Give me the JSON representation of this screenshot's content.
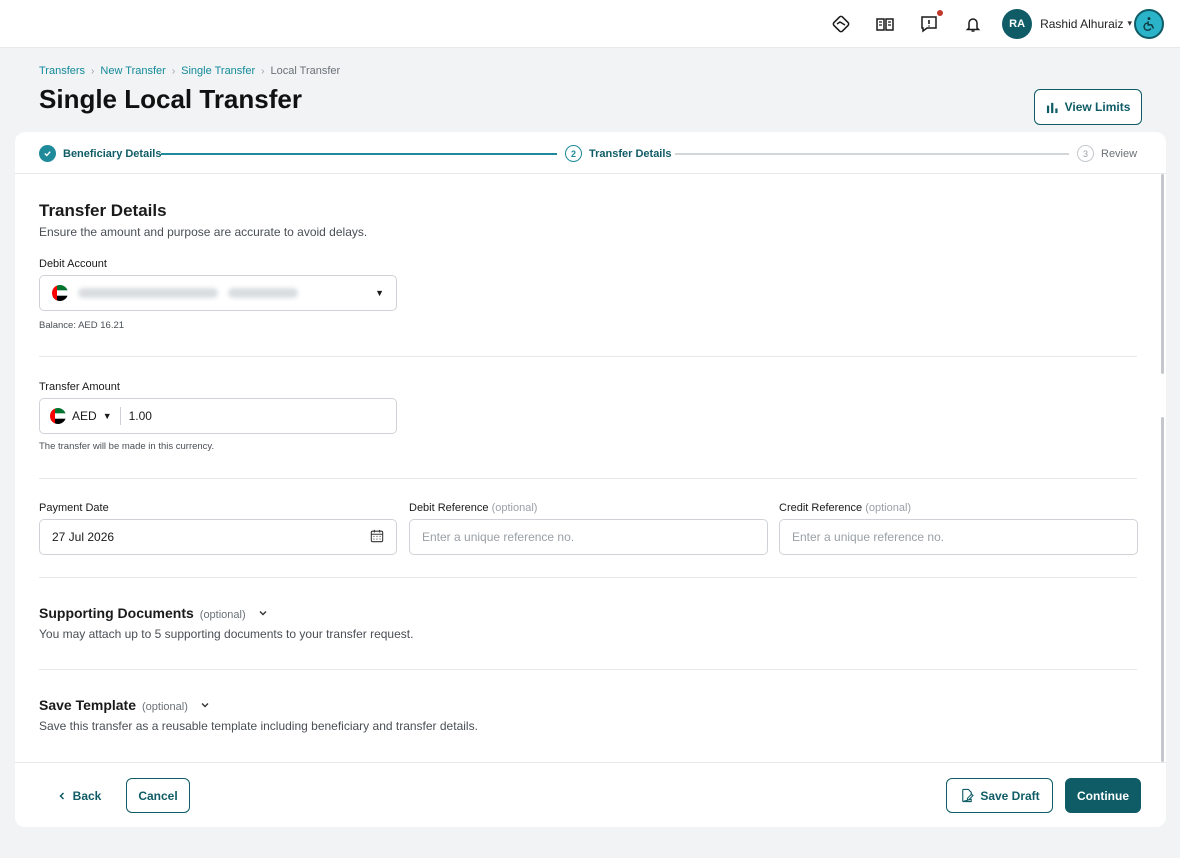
{
  "topbar": {
    "user_initials": "RA",
    "user_name": "Rashid Alhuraiz",
    "icons": [
      "handshake-icon",
      "book-icon",
      "feedback-icon",
      "bell-icon",
      "accessibility-icon"
    ]
  },
  "breadcrumb": [
    "Transfers",
    "New Transfer",
    "Single Transfer",
    "Local Transfer"
  ],
  "page_title": "Single Local Transfer",
  "view_limits_label": "View Limits",
  "stepper": {
    "steps": [
      {
        "number": "1",
        "label": "Beneficiary Details",
        "state": "done"
      },
      {
        "number": "2",
        "label": "Transfer Details",
        "state": "active"
      },
      {
        "number": "3",
        "label": "Review",
        "state": "todo"
      }
    ]
  },
  "transfer_details": {
    "title": "Transfer Details",
    "subtitle": "Ensure the amount and purpose are accurate to avoid delays.",
    "debit_account": {
      "label": "Debit Account",
      "balance_text": "Balance: AED 16.21"
    },
    "transfer_amount": {
      "label": "Transfer Amount",
      "currency": "AED",
      "value": "1.00",
      "helper": "The transfer will be made in this currency."
    },
    "payment_date": {
      "label": "Payment Date",
      "value": "27 Jul 2026"
    },
    "debit_reference": {
      "label": "Debit Reference",
      "optional": "(optional)",
      "placeholder": "Enter a unique reference no."
    },
    "credit_reference": {
      "label": "Credit Reference",
      "optional": "(optional)",
      "placeholder": "Enter a unique reference no."
    }
  },
  "supporting_documents": {
    "title": "Supporting Documents",
    "optional": "(optional)",
    "subtitle": "You may attach up to 5 supporting documents to your transfer request."
  },
  "save_template": {
    "title": "Save Template",
    "optional": "(optional)",
    "subtitle": "Save this transfer as a reusable template including beneficiary and transfer details."
  },
  "footer": {
    "back_label": "Back",
    "cancel_label": "Cancel",
    "save_draft_label": "Save Draft",
    "continue_label": "Continue"
  },
  "colors": {
    "brand": "#0f5c66",
    "accent": "#1e8a9a",
    "link": "#138a9a"
  }
}
